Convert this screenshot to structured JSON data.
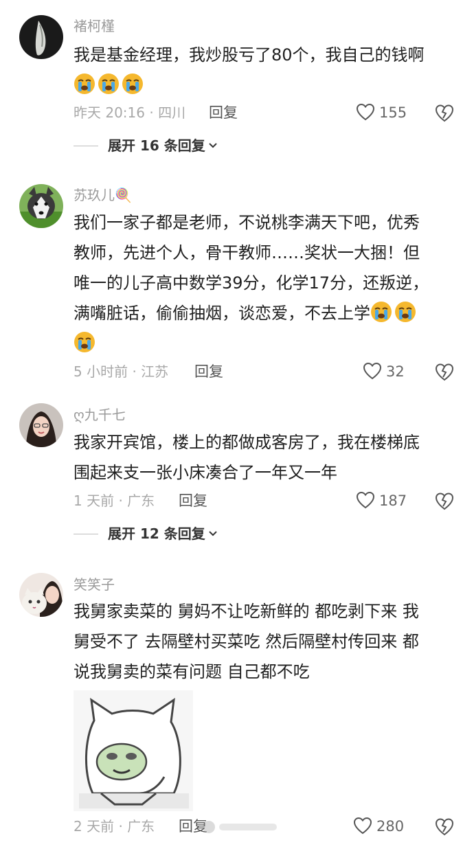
{
  "comments": [
    {
      "username": "褚柯槿",
      "text": "我是基金经理，我炒股亏了80个，我自己的钱啊",
      "emoji": [
        "crying-emoji",
        "crying-emoji",
        "crying-emoji"
      ],
      "meta": "昨天 20:16 · 四川",
      "reply_label": "回复",
      "likes": "155",
      "expand_label": "展开 16 条回复"
    },
    {
      "username": "苏玖儿🍭",
      "text_lines": [
        "我们一家子都是老师，不说桃李满天下吧，优秀",
        "教师，先进个人，骨干教师……奖状一大捆！但",
        "唯一的儿子高中数学39分，化学17分，还叛逆，",
        "满嘴脏话，偷偷抽烟，谈恋爱，不去上学"
      ],
      "emoji": [
        "crying-emoji",
        "crying-emoji",
        "crying-emoji"
      ],
      "meta": "5 小时前 · 江苏",
      "reply_label": "回复",
      "likes": "32"
    },
    {
      "username": "ღ九千七",
      "text_lines": [
        "我家开宾馆，楼上的都做成客房了，我在楼梯底",
        "围起来支一张小床凑合了一年又一年"
      ],
      "meta": "1 天前 · 广东",
      "reply_label": "回复",
      "likes": "187",
      "expand_label": "展开 12 条回复"
    },
    {
      "username": "笑笑子",
      "text_lines": [
        "我舅家卖菜的 舅妈不让吃新鲜的 都吃剥下来 我",
        "舅受不了 去隔壁村买菜吃 然后隔壁村传回来 都",
        "说我舅卖的菜有问题 自己都不吃"
      ],
      "meta": "2 天前 · 广东",
      "reply_label": "回复",
      "likes": "280"
    }
  ],
  "colors": {
    "username": "#9a9a9a",
    "text": "#1f1f1f",
    "meta": "#a8a8a8",
    "emoji": "#f5b82e"
  }
}
